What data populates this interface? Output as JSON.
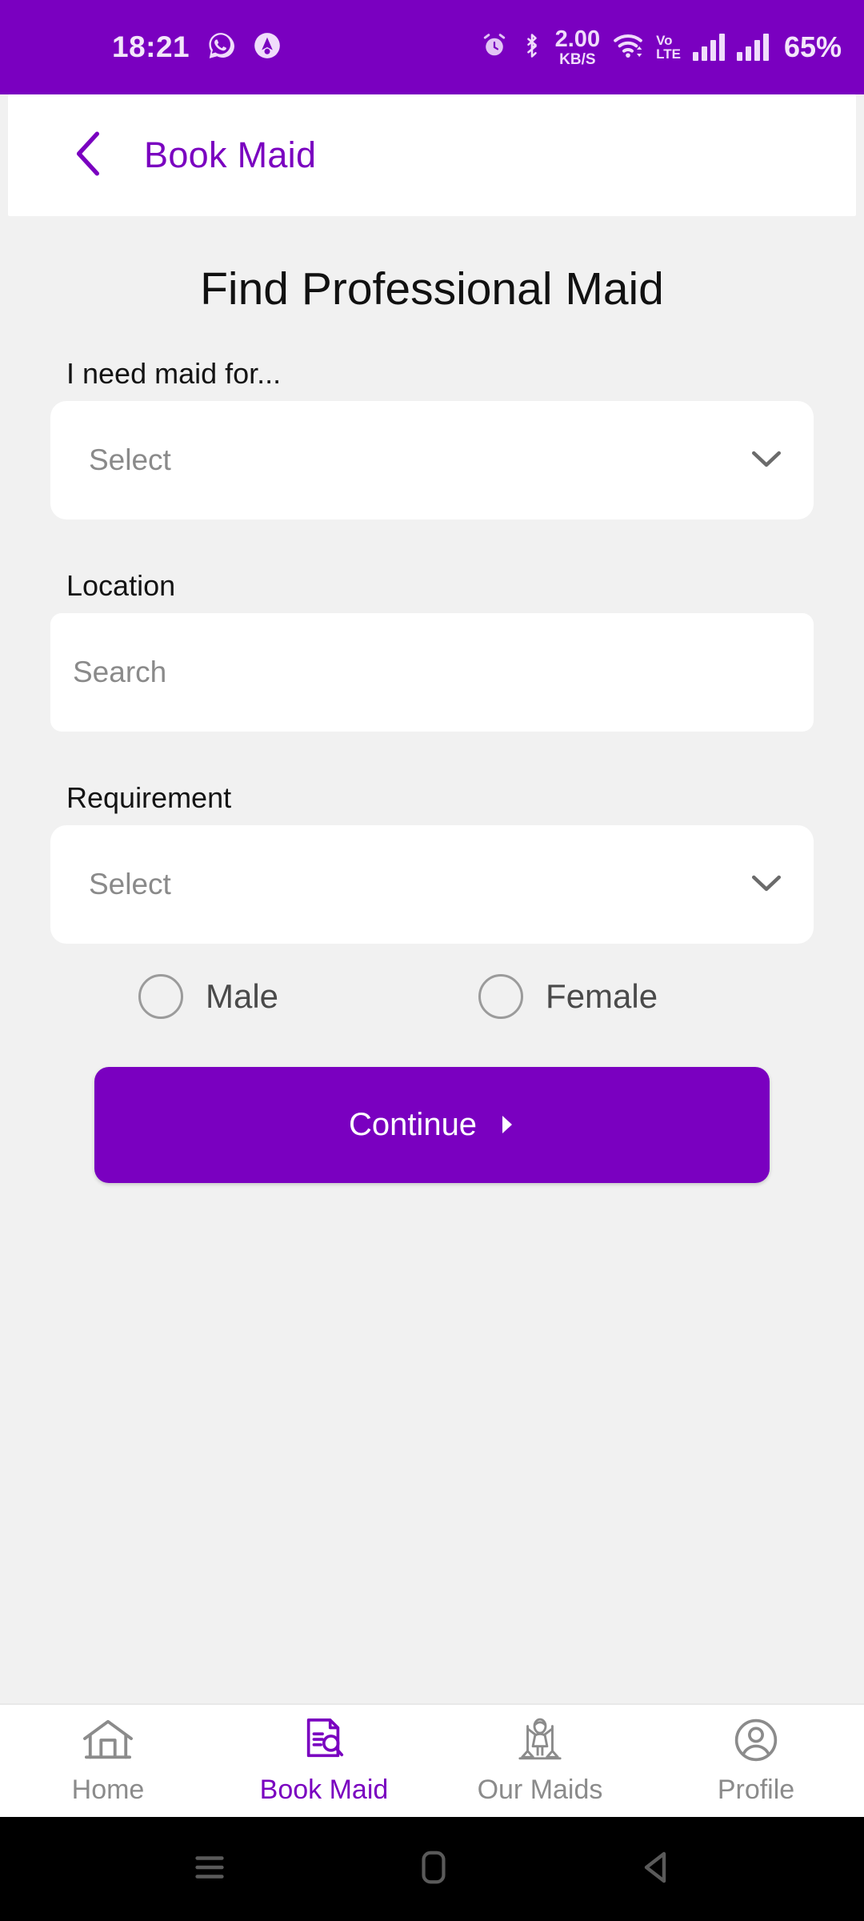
{
  "status_bar": {
    "time": "18:21",
    "icons_left": [
      "whatsapp-icon",
      "app-circle-icon"
    ],
    "alarm_icon": "alarm-icon",
    "bluetooth_icon": "bluetooth-icon",
    "net_speed_value": "2.00",
    "net_speed_unit": "KB/S",
    "wifi_icon": "wifi-icon",
    "volte_line1": "Vo",
    "volte_line2": "LTE",
    "battery": "65%",
    "background_color": "#7a00c0"
  },
  "app_bar": {
    "back_icon": "back-chevron-icon",
    "title": "Book Maid",
    "accent_color": "#7a00c0"
  },
  "main": {
    "page_title": "Find Professional Maid",
    "fields": [
      {
        "label": "I need maid for...",
        "value": "Select",
        "type": "dropdown"
      },
      {
        "label": "Location",
        "value": "Search",
        "type": "text"
      },
      {
        "label": "Requirement",
        "value": "Select",
        "type": "dropdown"
      }
    ],
    "gender": {
      "options": [
        {
          "label": "Male",
          "selected": false
        },
        {
          "label": "Female",
          "selected": false
        }
      ]
    },
    "continue_button": {
      "label": "Continue",
      "color": "#7a00c0"
    }
  },
  "bottom_nav": {
    "items": [
      {
        "label": "Home",
        "icon": "house-icon",
        "active": false
      },
      {
        "label": "Book Maid",
        "icon": "document-search-icon",
        "active": true
      },
      {
        "label": "Our Maids",
        "icon": "maid-broom-icon",
        "active": false
      },
      {
        "label": "Profile",
        "icon": "person-circle-icon",
        "active": false
      }
    ],
    "active_color": "#7a00c0",
    "inactive_color": "#8b8b8b"
  },
  "system_nav": {
    "buttons": [
      "recents-icon",
      "home-square-icon",
      "back-triangle-icon"
    ]
  }
}
